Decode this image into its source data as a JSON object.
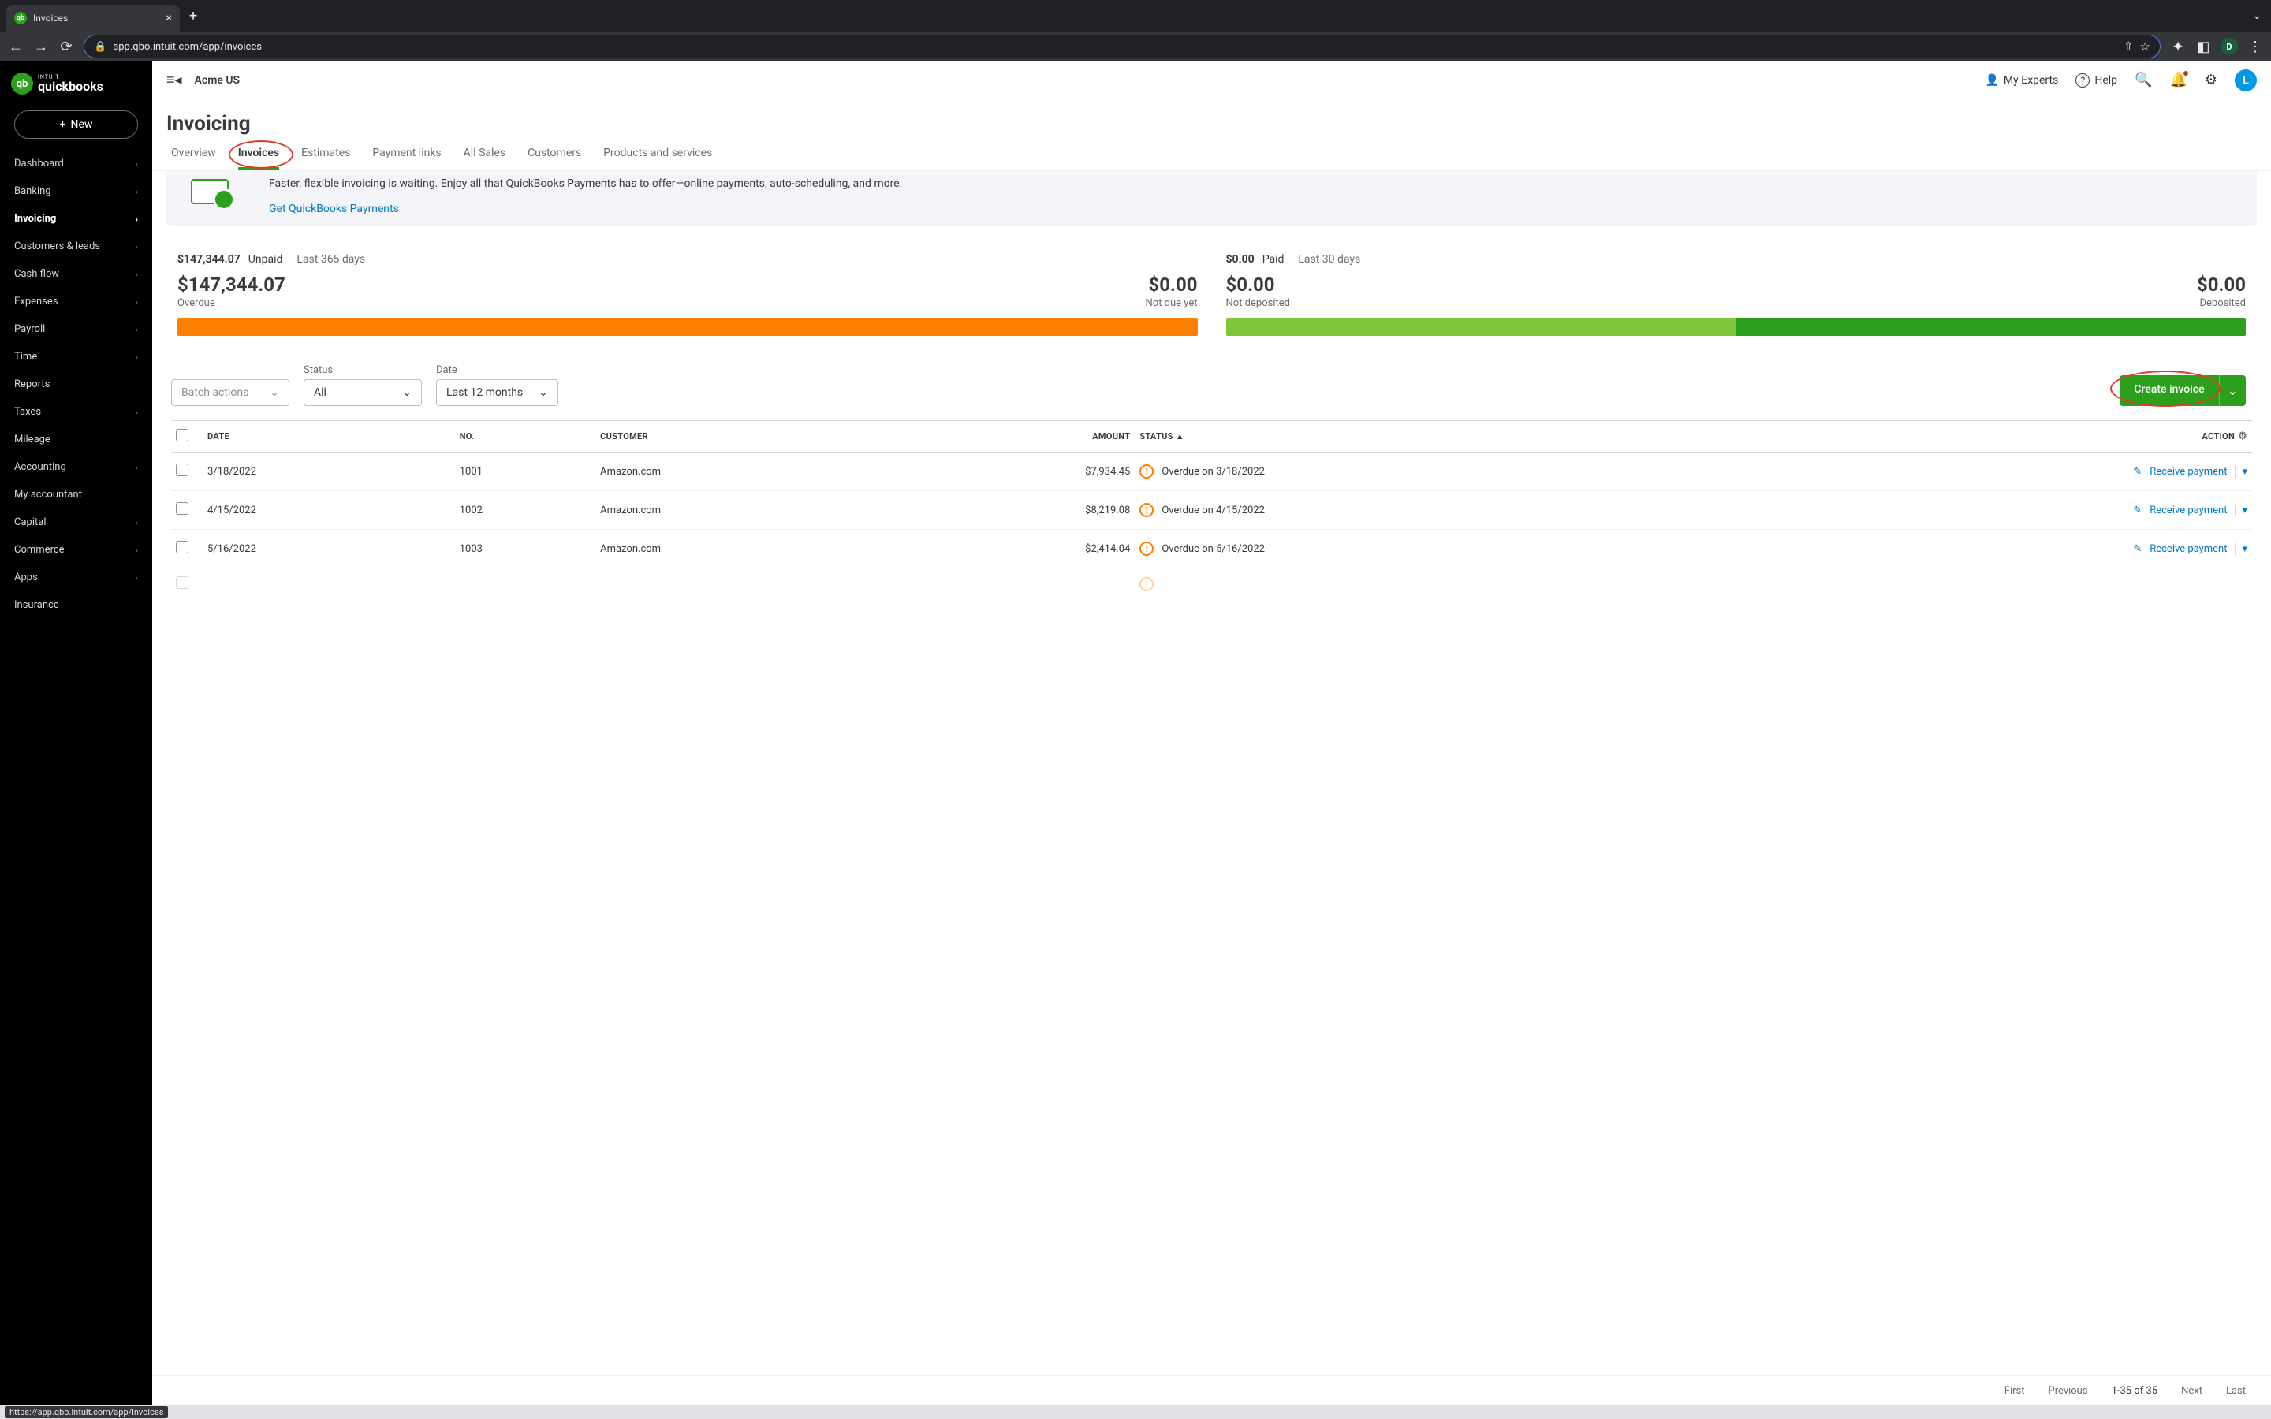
{
  "browser": {
    "tab_title": "Invoices",
    "url": "app.qbo.intuit.com/app/invoices",
    "profile_letter": "D",
    "hover_url": "https://app.qbo.intuit.com/app/invoices"
  },
  "header": {
    "company": "Acme US",
    "experts": "My Experts",
    "help": "Help",
    "avatar_letter": "L"
  },
  "sidebar": {
    "brand_top": "INTUIT",
    "brand": "quickbooks",
    "new_label": "New",
    "items": [
      {
        "label": "Dashboard",
        "chev": true
      },
      {
        "label": "Banking",
        "chev": true
      },
      {
        "label": "Invoicing",
        "chev": true,
        "active": true
      },
      {
        "label": "Customers & leads",
        "chev": true
      },
      {
        "label": "Cash flow",
        "chev": true
      },
      {
        "label": "Expenses",
        "chev": true
      },
      {
        "label": "Payroll",
        "chev": true
      },
      {
        "label": "Time",
        "chev": true
      },
      {
        "label": "Reports",
        "chev": false
      },
      {
        "label": "Taxes",
        "chev": true
      },
      {
        "label": "Mileage",
        "chev": false
      },
      {
        "label": "Accounting",
        "chev": true
      },
      {
        "label": "My accountant",
        "chev": false
      },
      {
        "label": "Capital",
        "chev": true
      },
      {
        "label": "Commerce",
        "chev": true
      },
      {
        "label": "Apps",
        "chev": true
      },
      {
        "label": "Insurance",
        "chev": false
      }
    ]
  },
  "page": {
    "title": "Invoicing",
    "tabs": [
      "Overview",
      "Invoices",
      "Estimates",
      "Payment links",
      "All Sales",
      "Customers",
      "Products and services"
    ],
    "promo_text": "Faster, flexible invoicing is waiting. Enjoy all that QuickBooks Payments has to offer—online payments, auto-scheduling, and more.",
    "promo_link": "Get QuickBooks Payments"
  },
  "summary": {
    "unpaid": {
      "total": "$147,344.07",
      "label": "Unpaid",
      "period": "Last 365 days",
      "l_val": "$147,344.07",
      "l_lab": "Overdue",
      "r_val": "$0.00",
      "r_lab": "Not due yet"
    },
    "paid": {
      "total": "$0.00",
      "label": "Paid",
      "period": "Last 30 days",
      "l_val": "$0.00",
      "l_lab": "Not deposited",
      "r_val": "$0.00",
      "r_lab": "Deposited"
    }
  },
  "filters": {
    "batch": "Batch actions",
    "status_label": "Status",
    "status_value": "All",
    "date_label": "Date",
    "date_value": "Last 12 months",
    "create": "Create invoice"
  },
  "table": {
    "cols": {
      "date": "DATE",
      "no": "NO.",
      "customer": "CUSTOMER",
      "amount": "AMOUNT",
      "status": "STATUS ▲",
      "action": "ACTION"
    },
    "rows": [
      {
        "date": "3/18/2022",
        "no": "1001",
        "cust": "Amazon.com",
        "amount": "$7,934.45",
        "status": "Overdue on 3/18/2022",
        "act": "Receive payment"
      },
      {
        "date": "4/15/2022",
        "no": "1002",
        "cust": "Amazon.com",
        "amount": "$8,219.08",
        "status": "Overdue on 4/15/2022",
        "act": "Receive payment"
      },
      {
        "date": "5/16/2022",
        "no": "1003",
        "cust": "Amazon.com",
        "amount": "$2,414.04",
        "status": "Overdue on 5/16/2022",
        "act": "Receive payment"
      }
    ]
  },
  "pager": {
    "first": "First",
    "prev": "Previous",
    "range": "1-35 of 35",
    "next": "Next",
    "last": "Last"
  }
}
